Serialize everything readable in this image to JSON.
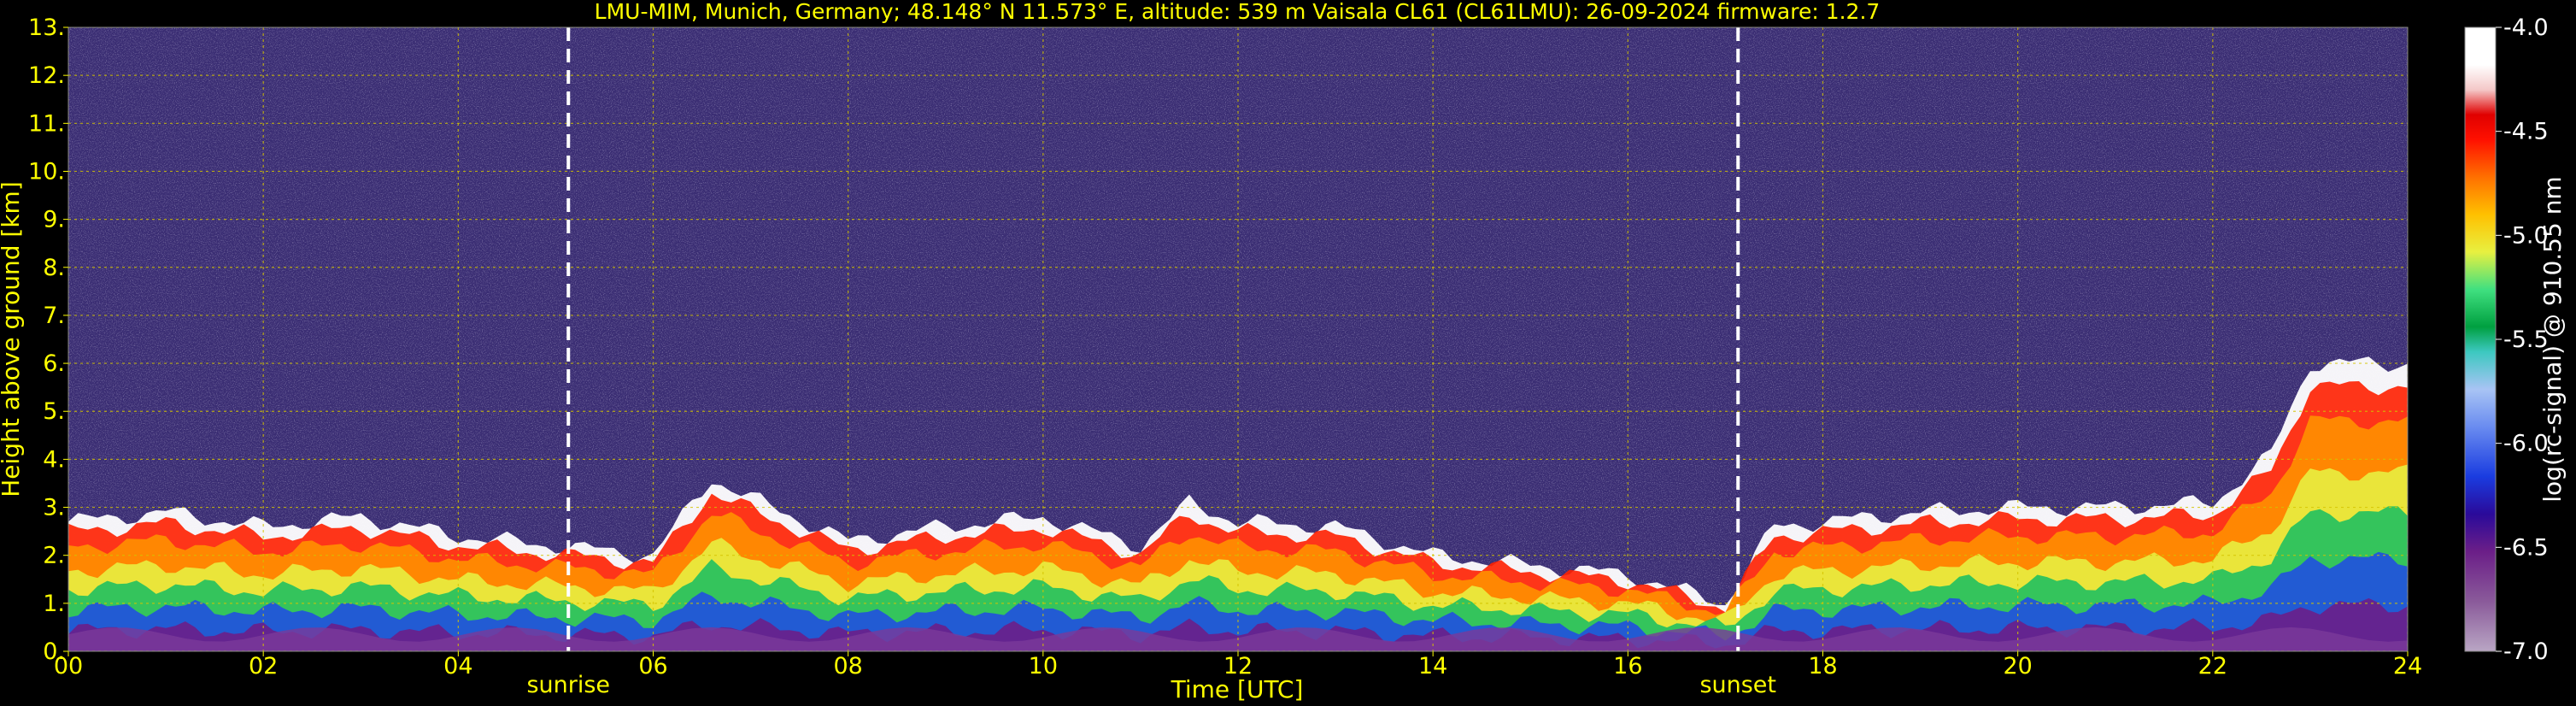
{
  "chart_data": {
    "type": "heatmap",
    "title": "LMU-MIM, Munich, Germany; 48.148° N 11.573° E, altitude: 539 m    Vaisala CL61 (CL61LMU): 26-09-2024    firmware: 1.2.7",
    "xlabel": "Time [UTC]",
    "ylabel": "Height above ground [km]",
    "xlim": [
      0,
      24
    ],
    "ylim": [
      0,
      13
    ],
    "x_ticks": [
      "00",
      "02",
      "04",
      "06",
      "08",
      "10",
      "12",
      "14",
      "16",
      "18",
      "20",
      "22",
      "24"
    ],
    "y_ticks": [
      "0.",
      "1.",
      "2.",
      "3.",
      "4.",
      "5.",
      "6.",
      "7.",
      "8.",
      "9.",
      "10.",
      "11.",
      "12.",
      "13."
    ],
    "grid": true,
    "colorbar": {
      "label": "log(rc-signal) @ 910.55 nm",
      "range": [
        -7.0,
        -4.0
      ],
      "ticks": [
        "-4.0",
        "-4.5",
        "-5.0",
        "-5.5",
        "-6.0",
        "-6.5",
        "-7.0"
      ]
    },
    "events": [
      {
        "label": "sunrise",
        "time": 5.13
      },
      {
        "label": "sunset",
        "time": 17.13
      }
    ],
    "cloud_layer_top_km": [
      [
        0,
        2.7
      ],
      [
        1,
        2.9
      ],
      [
        2,
        2.6
      ],
      [
        3,
        2.8
      ],
      [
        4,
        2.4
      ],
      [
        5,
        2.2
      ],
      [
        6,
        2.0
      ],
      [
        6.6,
        3.6
      ],
      [
        7,
        3.2
      ],
      [
        8,
        2.3
      ],
      [
        9,
        2.6
      ],
      [
        10,
        2.8
      ],
      [
        11,
        2.2
      ],
      [
        11.5,
        3.1
      ],
      [
        12,
        2.7
      ],
      [
        13,
        2.6
      ],
      [
        14,
        2.0
      ],
      [
        15,
        1.8
      ],
      [
        16,
        1.6
      ],
      [
        17,
        1.0
      ],
      [
        17.5,
        2.6
      ],
      [
        18,
        2.7
      ],
      [
        19,
        2.9
      ],
      [
        20,
        3.0
      ],
      [
        21,
        3.0
      ],
      [
        22,
        3.1
      ],
      [
        22.6,
        4.1
      ],
      [
        23,
        6.0
      ]
    ]
  }
}
